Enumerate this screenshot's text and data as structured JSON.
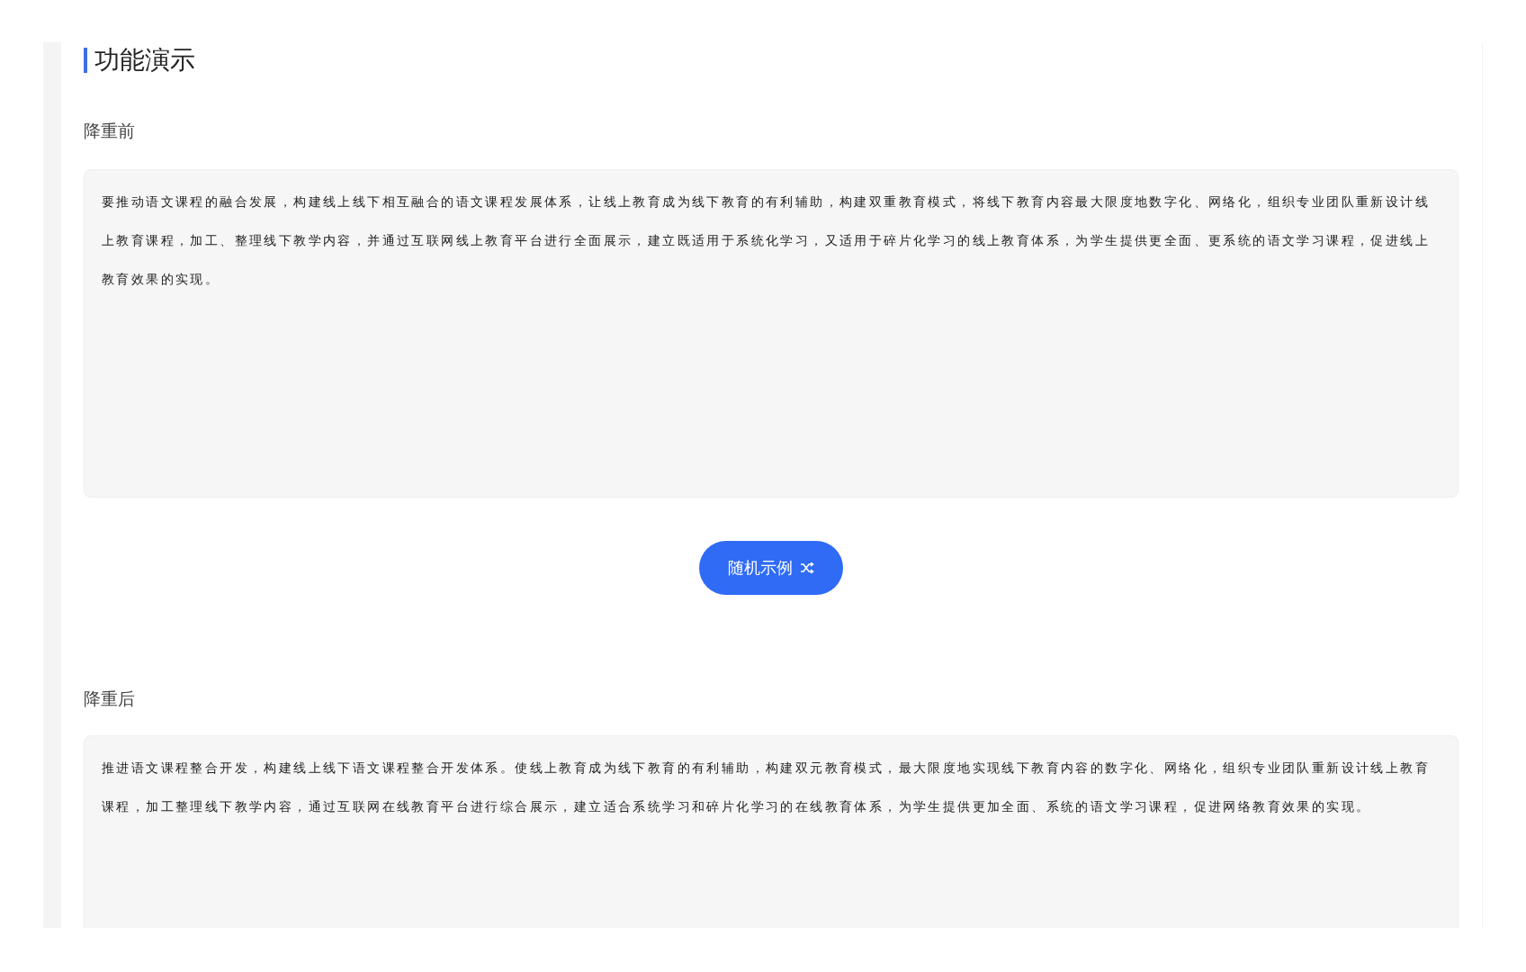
{
  "section_title": "功能演示",
  "before": {
    "label": "降重前",
    "text": "要推动语文课程的融合发展，构建线上线下相互融合的语文课程发展体系，让线上教育成为线下教育的有利辅助，构建双重教育模式，将线下教育内容最大限度地数字化、网络化，组织专业团队重新设计线上教育课程，加工、整理线下教学内容，并通过互联网线上教育平台进行全面展示，建立既适用于系统化学习，又适用于碎片化学习的线上教育体系，为学生提供更全面、更系统的语文学习课程，促进线上教育效果的实现。"
  },
  "random_button": {
    "label": "随机示例"
  },
  "after": {
    "label": "降重后",
    "text": "推进语文课程整合开发，构建线上线下语文课程整合开发体系。使线上教育成为线下教育的有利辅助，构建双元教育模式，最大限度地实现线下教育内容的数字化、网络化，组织专业团队重新设计线上教育课程，加工整理线下教学内容，通过互联网在线教育平台进行综合展示，建立适合系统学习和碎片化学习的在线教育体系，为学生提供更加全面、系统的语文学习课程，促进网络教育效果的实现。"
  }
}
